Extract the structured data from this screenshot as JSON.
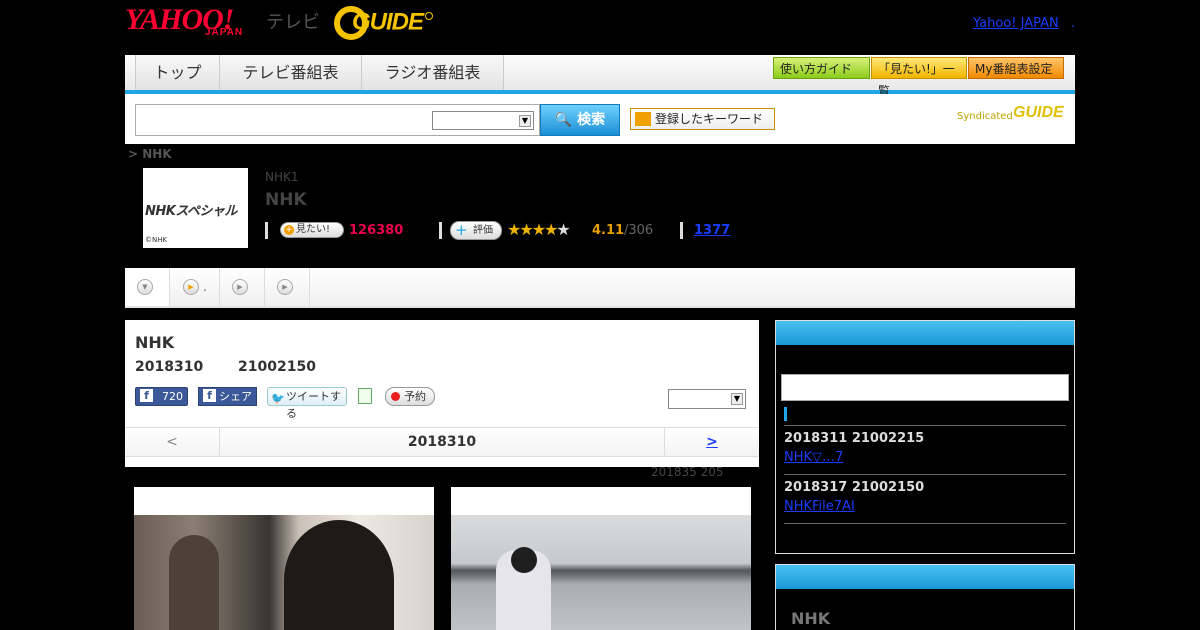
{
  "header": {
    "yahoo": "YAHOO!",
    "japan": "JAPAN",
    "tv": "テレビ",
    "gguide": "GUIDE",
    "yahoo_japan_link": "Yahoo! JAPAN",
    "dot": "."
  },
  "nav": {
    "tabs": [
      "トップ",
      "テレビ番組表",
      "ラジオ番組表"
    ],
    "buttons": [
      "使い方ガイド",
      "「見たい!」一覧",
      "My番組表設定"
    ]
  },
  "search": {
    "button": "検索",
    "keyword_button": "登録したキーワード",
    "syndicated": "Syndicated",
    "syndicated_logo": "GUIDE"
  },
  "breadcrumb": "> NHK",
  "program": {
    "thumb_title": "NHKスペシャル",
    "thumb_copy": "©NHK",
    "channel": "NHK1",
    "name": "NHK",
    "want_button": "見たい!",
    "want_count": "126380",
    "rate_button": "評価",
    "rating": "4.11",
    "rating_count": "/306",
    "review_link": "1377",
    "stars_filled": 4
  },
  "subtabs": {
    "tab2_text": "."
  },
  "main": {
    "title": "NHK",
    "date": "2018310",
    "time": "21002150",
    "like_count": "720",
    "share": "シェア",
    "tweet": "ツイートする",
    "reserve": "予約",
    "pager_prev": "<",
    "pager_date": "2018310",
    "pager_next": ">",
    "updated": "201835  205"
  },
  "sidebar": {
    "items": [
      {
        "date": "2018311  21002215",
        "link": "NHK▽…7 "
      },
      {
        "date": "2018317  21002150",
        "link": "NHKFile7AI     "
      }
    ],
    "box2_text": "NHK"
  },
  "colors": {
    "accent": "#1fa6e6",
    "brand_red": "#ff0033",
    "gguide_yellow": "#f5c400",
    "want_pink": "#e8004c"
  }
}
